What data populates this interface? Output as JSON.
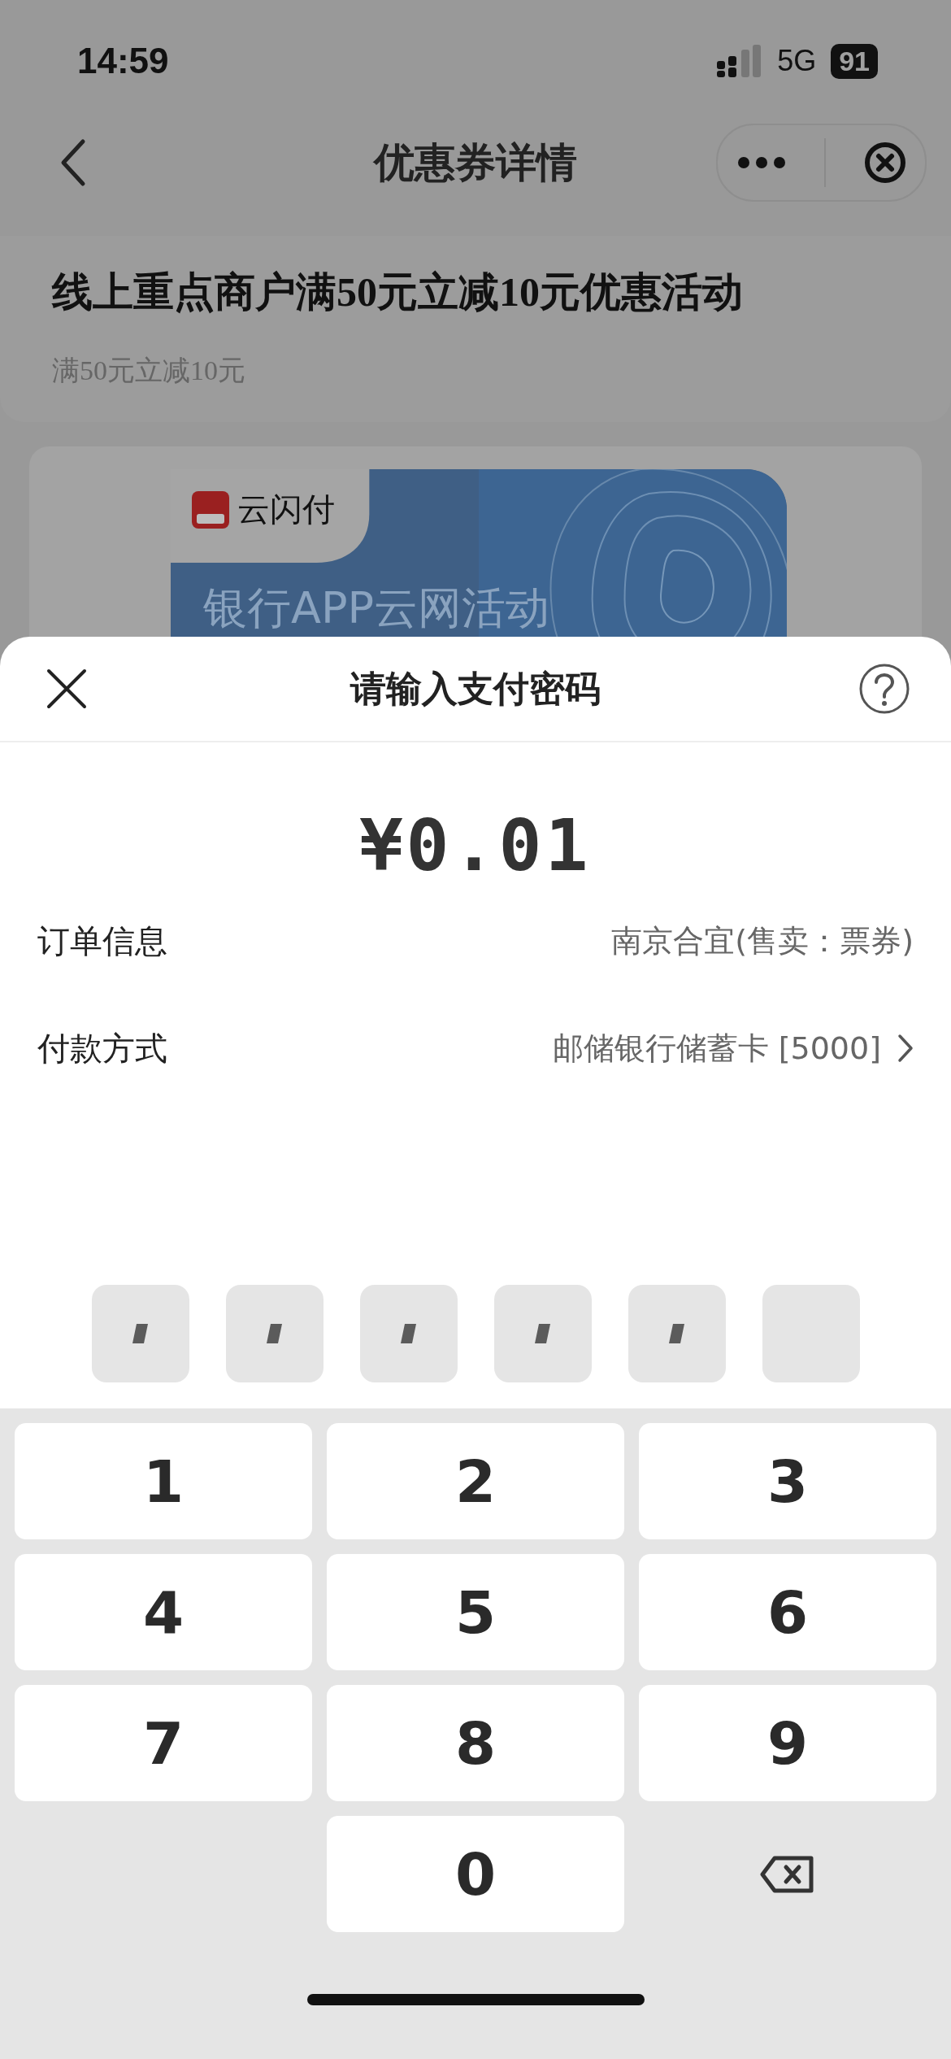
{
  "status_bar": {
    "time": "14:59",
    "network": "5G",
    "battery": "91"
  },
  "nav": {
    "title": "优惠券详情"
  },
  "coupon": {
    "title": "线上重点商户满50元立减10元优惠活动",
    "subtitle": "满50元立减10元"
  },
  "banner": {
    "brand": "云闪付",
    "headline": "银行APP云网活动"
  },
  "sheet": {
    "title": "请输入支付密码",
    "amount": "¥0.01",
    "rows": [
      {
        "label": "订单信息",
        "value": "南京合宜(售卖：票券)",
        "chevron": false
      },
      {
        "label": "付款方式",
        "value": "邮储银行储蓄卡 [5000]",
        "chevron": true
      }
    ],
    "pin": [
      {
        "filled": true
      },
      {
        "filled": true
      },
      {
        "filled": true
      },
      {
        "filled": true
      },
      {
        "filled": true
      },
      {
        "filled": false
      }
    ]
  },
  "keypad": [
    {
      "kind": "digit",
      "label": "1"
    },
    {
      "kind": "digit",
      "label": "2"
    },
    {
      "kind": "digit",
      "label": "3"
    },
    {
      "kind": "digit",
      "label": "4"
    },
    {
      "kind": "digit",
      "label": "5"
    },
    {
      "kind": "digit",
      "label": "6"
    },
    {
      "kind": "digit",
      "label": "7"
    },
    {
      "kind": "digit",
      "label": "8"
    },
    {
      "kind": "digit",
      "label": "9"
    },
    {
      "kind": "blank"
    },
    {
      "kind": "digit",
      "label": "0"
    },
    {
      "kind": "backspace"
    }
  ]
}
